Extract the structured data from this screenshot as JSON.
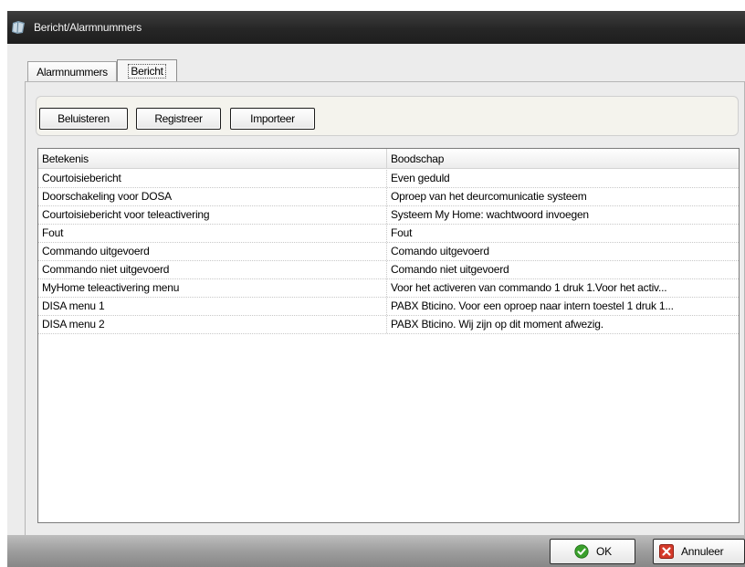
{
  "window": {
    "title": "Bericht/Alarmnummers",
    "title_icon": "book-icon"
  },
  "tabs": [
    {
      "label": "Alarmnummers",
      "active": false
    },
    {
      "label": "Bericht",
      "active": true
    }
  ],
  "toolbar": {
    "listen_label": "Beluisteren",
    "record_label": "Registreer",
    "import_label": "Importeer"
  },
  "table": {
    "columns": [
      "Betekenis",
      "Boodschap"
    ],
    "rows": [
      [
        "Courtoisiebericht",
        "Even geduld"
      ],
      [
        "Doorschakeling voor DOSA",
        "Oproep van het deurcomunicatie systeem"
      ],
      [
        "Courtoisiebericht voor teleactivering",
        "Systeem My Home: wachtwoord invoegen"
      ],
      [
        "Fout",
        "Fout"
      ],
      [
        "Commando uitgevoerd",
        "Comando uitgevoerd"
      ],
      [
        "Commando niet uitgevoerd",
        "Comando niet uitgevoerd"
      ],
      [
        "MyHome teleactivering menu",
        "Voor het activeren van commando 1 druk 1.Voor het activ..."
      ],
      [
        "DISA menu 1",
        "PABX Bticino. Voor een oproep naar intern toestel 1 druk 1..."
      ],
      [
        "DISA menu 2",
        "PABX Bticino. Wij zijn op dit moment afwezig."
      ]
    ]
  },
  "footer": {
    "ok_label": "OK",
    "ok_icon": "check-circle-icon",
    "cancel_label": "Annuleer",
    "cancel_icon": "close-x-icon"
  },
  "colors": {
    "titlebar": "#262626",
    "ok_green": "#3aa02c",
    "cancel_red": "#d43a2a"
  }
}
